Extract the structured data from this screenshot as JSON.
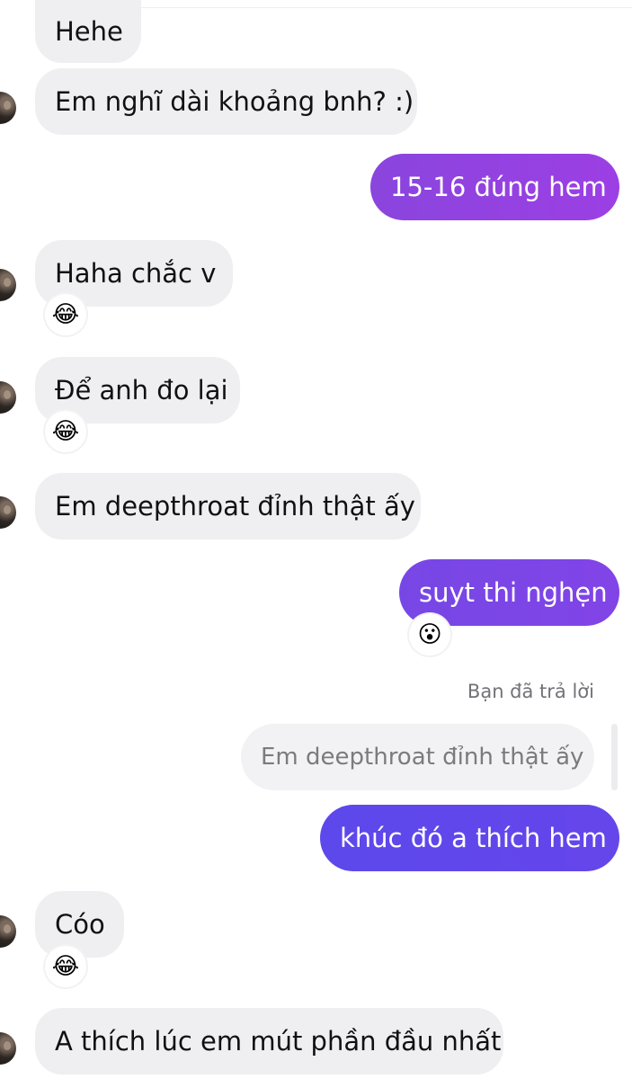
{
  "messages": [
    {
      "id": "m1",
      "text": "Hehe"
    },
    {
      "id": "m2",
      "text": "Em nghĩ dài khoảng bnh? :)"
    },
    {
      "id": "m3",
      "text": "15-16 đúng hem"
    },
    {
      "id": "m4",
      "text": "Haha chắc v",
      "reaction": "😂"
    },
    {
      "id": "m5",
      "text": "Để anh đo lại",
      "reaction": "😂"
    },
    {
      "id": "m6",
      "text": "Em deepthroat đỉnh thật ấy"
    },
    {
      "id": "m7",
      "text": "suyt thi nghẹn",
      "reaction": "😮"
    },
    {
      "id": "m8",
      "text": "khúc đó a thích hem"
    },
    {
      "id": "m9",
      "text": "Cóo",
      "reaction": "😂"
    },
    {
      "id": "m10",
      "text": "A thích lúc em mút phần đầu nhất"
    }
  ],
  "reply_context": {
    "label": "Bạn đã trả lời",
    "quoted_text": "Em deepthroat đỉnh thật ấy"
  }
}
